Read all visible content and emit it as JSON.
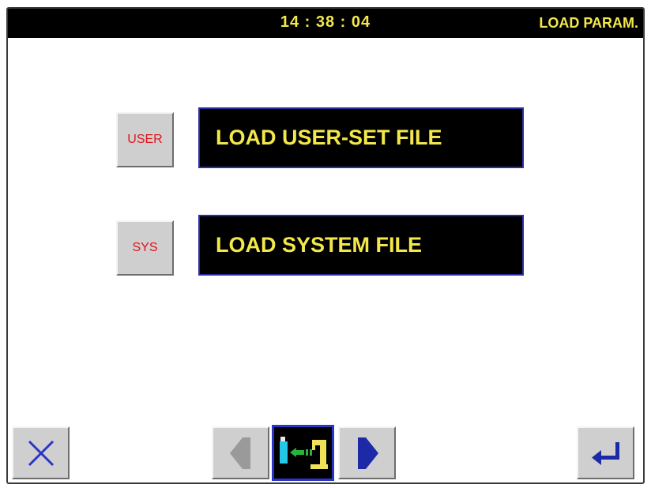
{
  "header": {
    "time": "14 : 38 : 04",
    "title": "LOAD PARAM."
  },
  "menu": [
    {
      "key_label": "USER",
      "action_label": "LOAD USER-SET FILE"
    },
    {
      "key_label": "SYS",
      "action_label": "LOAD SYSTEM FILE"
    }
  ],
  "toolbar": {
    "cancel_icon": "close-icon",
    "prev_icon": "arrow-left-icon",
    "current_icon": "usb-to-machine-icon",
    "next_icon": "arrow-right-icon",
    "enter_icon": "enter-icon",
    "prev_disabled": true
  },
  "colors": {
    "header_text": "#f2e84a",
    "key_text": "#e0141c",
    "frame_blue": "#2a35c8"
  }
}
